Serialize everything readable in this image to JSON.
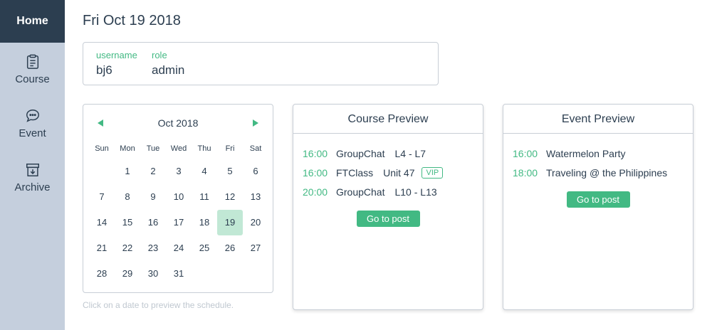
{
  "sidebar": {
    "home": "Home",
    "items": [
      {
        "label": "Course",
        "icon": "clipboard-icon"
      },
      {
        "label": "Event",
        "icon": "chat-icon"
      },
      {
        "label": "Archive",
        "icon": "archive-icon"
      }
    ]
  },
  "header": {
    "date": "Fri Oct 19 2018"
  },
  "user": {
    "username_label": "username",
    "username": "bj6",
    "role_label": "role",
    "role": "admin"
  },
  "calendar": {
    "month": "Oct 2018",
    "weekdays": [
      "Sun",
      "Mon",
      "Tue",
      "Wed",
      "Thu",
      "Fri",
      "Sat"
    ],
    "weeks": [
      [
        "",
        "1",
        "2",
        "3",
        "4",
        "5",
        "6"
      ],
      [
        "7",
        "8",
        "9",
        "10",
        "11",
        "12",
        "13"
      ],
      [
        "14",
        "15",
        "16",
        "17",
        "18",
        "19",
        "20"
      ],
      [
        "21",
        "22",
        "23",
        "24",
        "25",
        "26",
        "27"
      ],
      [
        "28",
        "29",
        "30",
        "31",
        "",
        "",
        ""
      ]
    ],
    "selected": "19",
    "hint": "Click on a date to preview the schedule."
  },
  "course_preview": {
    "title": "Course Preview",
    "rows": [
      {
        "time": "16:00",
        "name": "GroupChat",
        "detail": "L4 - L7"
      },
      {
        "time": "16:00",
        "name": "FTClass",
        "detail": "Unit 47",
        "badge": "VIP"
      },
      {
        "time": "20:00",
        "name": "GroupChat",
        "detail": "L10 - L13"
      }
    ],
    "button": "Go to post"
  },
  "event_preview": {
    "title": "Event Preview",
    "rows": [
      {
        "time": "16:00",
        "name": "Watermelon Party"
      },
      {
        "time": "18:00",
        "name": "Traveling @ the Philippines"
      }
    ],
    "button": "Go to post"
  },
  "colors": {
    "accent": "#42b983",
    "sidebar": "#c5cfdd",
    "sidebar_active": "#2c3e50",
    "selected_day": "#c1e8d5"
  }
}
